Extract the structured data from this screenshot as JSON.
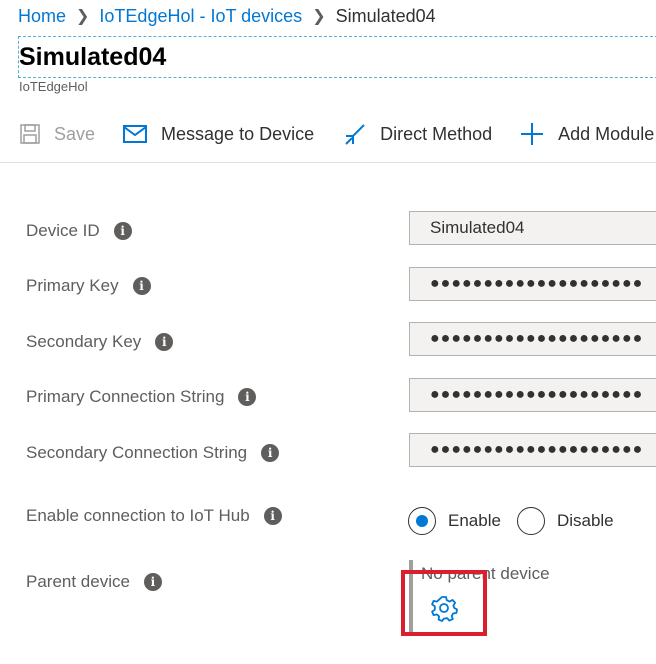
{
  "breadcrumb": {
    "home": "Home",
    "hub": "IoTEdgeHol - IoT devices",
    "current": "Simulated04"
  },
  "header": {
    "title": "Simulated04",
    "subtitle": "IoTEdgeHol"
  },
  "toolbar": {
    "save_label": "Save",
    "message_label": "Message to Device",
    "direct_method_label": "Direct Method",
    "add_module_label": "Add Module"
  },
  "fields": {
    "device_id": {
      "label": "Device ID",
      "value": "Simulated04"
    },
    "primary_key": {
      "label": "Primary Key",
      "value": "●●●●●●●●●●●●●●●●●●●●"
    },
    "secondary_key": {
      "label": "Secondary Key",
      "value": "●●●●●●●●●●●●●●●●●●●●"
    },
    "primary_conn": {
      "label": "Primary Connection String",
      "value": "●●●●●●●●●●●●●●●●●●●●"
    },
    "secondary_conn": {
      "label": "Secondary Connection String",
      "value": "●●●●●●●●●●●●●●●●●●●●"
    }
  },
  "connection": {
    "label": "Enable connection to IoT Hub",
    "enable": "Enable",
    "disable": "Disable",
    "selected": "Enable"
  },
  "parent": {
    "label": "Parent device",
    "value": "No parent device"
  },
  "colors": {
    "accent": "#0078d4",
    "highlight": "#d9202f"
  },
  "icons": {
    "info": "i",
    "save": "save-icon",
    "message": "envelope-icon",
    "direct_method": "direct-method-icon",
    "add": "plus-icon",
    "gear": "gear-icon"
  }
}
